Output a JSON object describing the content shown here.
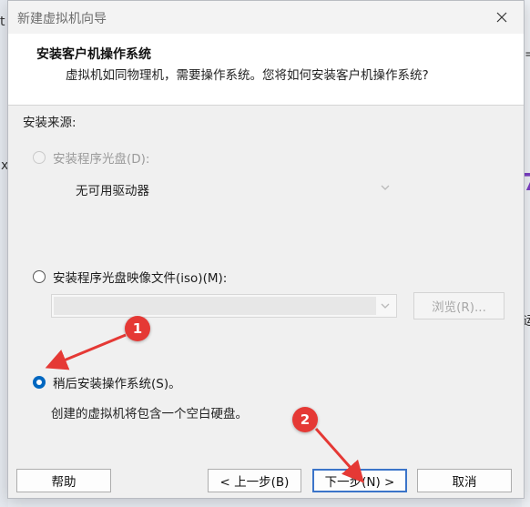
{
  "window": {
    "title": "新建虚拟机向导"
  },
  "header": {
    "title": "安装客户机操作系统",
    "subtitle": "虚拟机如同物理机，需要操作系统。您将如何安装客户机操作系统?"
  },
  "install_source": {
    "label": "安装来源:",
    "disc_option": {
      "label": "安装程序光盘(D):",
      "selected": false,
      "enabled": false
    },
    "disc_drive_select": {
      "value": "无可用驱动器",
      "enabled": false
    },
    "iso_option": {
      "label": "安装程序光盘映像文件(iso)(M):",
      "selected": false,
      "enabled": true
    },
    "iso_path_select": {
      "value": "",
      "enabled": false
    },
    "browse_button": {
      "label": "浏览(R)..."
    },
    "later_option": {
      "label": "稍后安装操作系统(S)。",
      "selected": true,
      "enabled": true
    },
    "later_description": "创建的虚拟机将包含一个空白硬盘。"
  },
  "buttons": {
    "help": "帮助",
    "back": "< 上一步(B)",
    "next": "下一步(N) >",
    "cancel": "取消"
  },
  "annotations": [
    {
      "number": "1",
      "color": "#e53935"
    },
    {
      "number": "2",
      "color": "#e53935"
    }
  ],
  "background_fragments": {
    "left_top": "t",
    "left_mid": "x",
    "right_top": "=",
    "right_purple": "7",
    "right_char": "运"
  },
  "colors": {
    "accent": "#0067c0",
    "annotation": "#e53935",
    "dialog_bg": "#f0f0f0",
    "header_bg": "#ffffff"
  },
  "icons": {
    "close": "close-icon",
    "dropdown": "chevron-down-icon"
  }
}
